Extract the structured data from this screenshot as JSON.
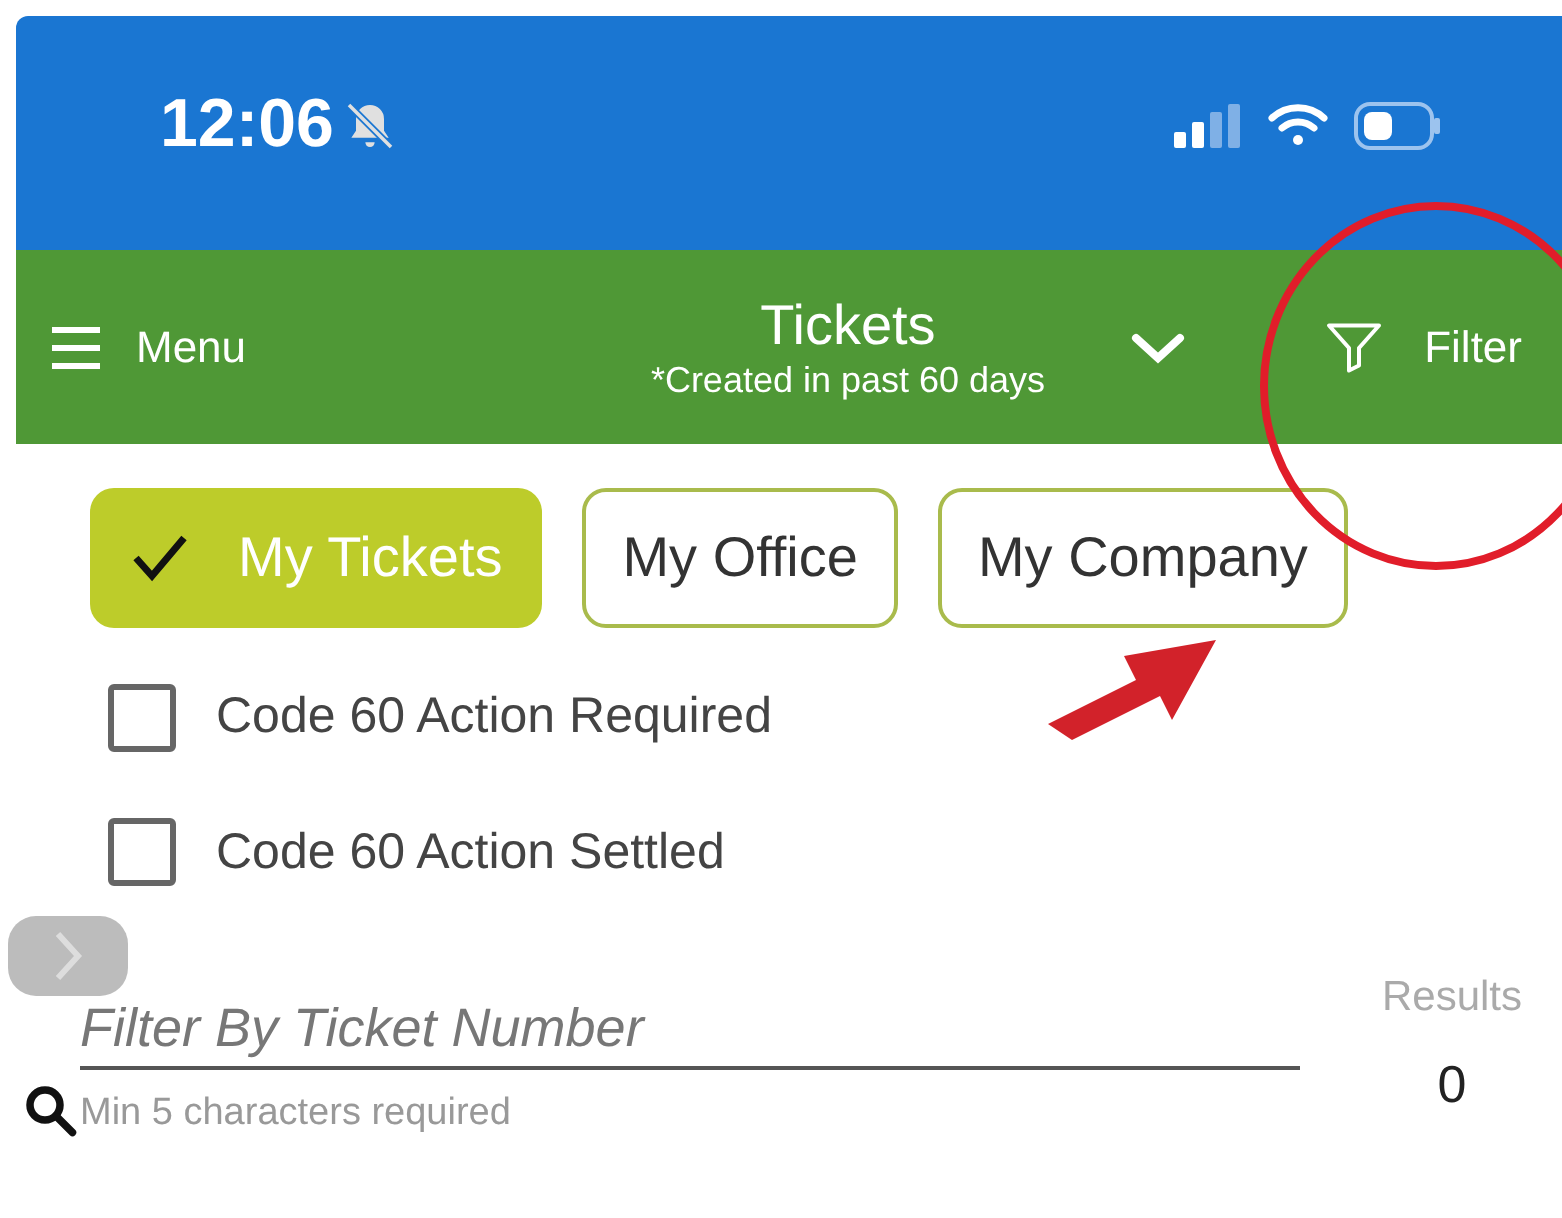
{
  "status_bar": {
    "time": "12:06"
  },
  "header": {
    "menu_label": "Menu",
    "title": "Tickets",
    "subtitle": "*Created in past 60 days",
    "filter_label": "Filter"
  },
  "scopes": [
    {
      "label": "My Tickets",
      "selected": true
    },
    {
      "label": "My Office",
      "selected": false
    },
    {
      "label": "My Company",
      "selected": false
    }
  ],
  "checkboxes": [
    {
      "label": "Code 60 Action Required",
      "checked": false
    },
    {
      "label": "Code 60 Action Settled",
      "checked": false
    }
  ],
  "search": {
    "placeholder": "Filter By Ticket Number",
    "hint": "Min 5 characters required"
  },
  "results": {
    "label": "Results",
    "count": "0"
  }
}
